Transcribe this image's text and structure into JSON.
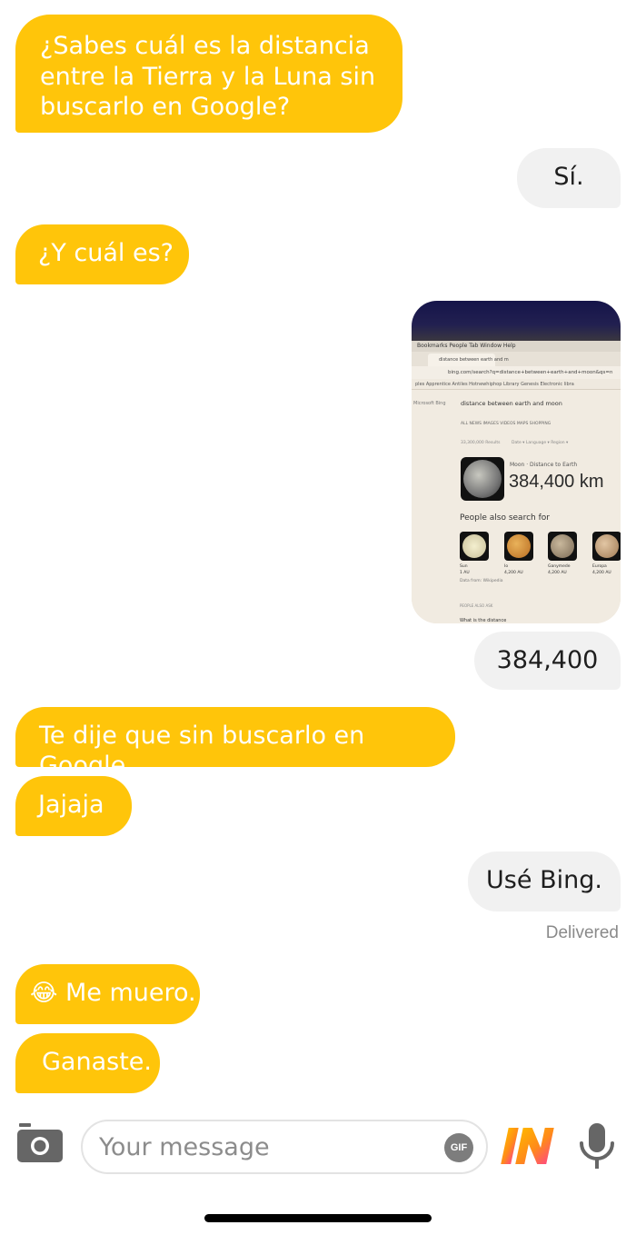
{
  "messages": [
    {
      "text": "¿Sabes cuál es la distancia entre la Tierra y la Luna sin buscarlo en Google?"
    },
    {
      "text": "Sí."
    },
    {
      "text": "¿Y cuál es?"
    },
    {
      "text": "384,400"
    },
    {
      "text": "Te dije que sin buscarlo en Google."
    },
    {
      "text": "Jajaja"
    },
    {
      "text": "Usé Bing."
    },
    {
      "emoji": "😂",
      "text": "Me muero."
    },
    {
      "text": "Ganaste."
    }
  ],
  "status": "Delivered",
  "photo": {
    "menu": "Bookmarks  People  Tab  Window  Help",
    "tab_title": "distance between earth and m",
    "url": "bing.com/search?q=distance+between+earth+and+moon&qs=n",
    "bookmarks": "ples   Apprentice Antiles   Hotnewhiphop   Library Genesis   Electronic libra",
    "engine": "Microsoft Bing",
    "query": "distance between earth and moon",
    "nav_tabs": "ALL    NEWS    IMAGES    VIDEOS    MAPS    SHOPPING",
    "results": "33,300,000 Results",
    "filters": "Date ▾          Language ▾          Region ▾",
    "answer_label": "Moon · Distance to Earth",
    "answer_value": "384,400 km",
    "also_search": "People also search for",
    "related": [
      {
        "name": "Sun",
        "value": "1 AU"
      },
      {
        "name": "Io",
        "value": "4,200 AU"
      },
      {
        "name": "Ganymede",
        "value": "4,200 AU"
      },
      {
        "name": "Europa",
        "value": "4,200 AU"
      }
    ],
    "data_from": "Data from: Wikipedia",
    "people_ask": "PEOPLE ALSO ASK",
    "question": "What is the distance"
  },
  "composer": {
    "placeholder": "Your message",
    "gif": "GIF",
    "logo": "IN"
  },
  "colors": {
    "incoming": "#ffc50a",
    "outgoing": "#f1f1f1"
  },
  "icons": [
    "camera-icon",
    "gif-icon",
    "in-logo-icon",
    "microphone-icon"
  ]
}
